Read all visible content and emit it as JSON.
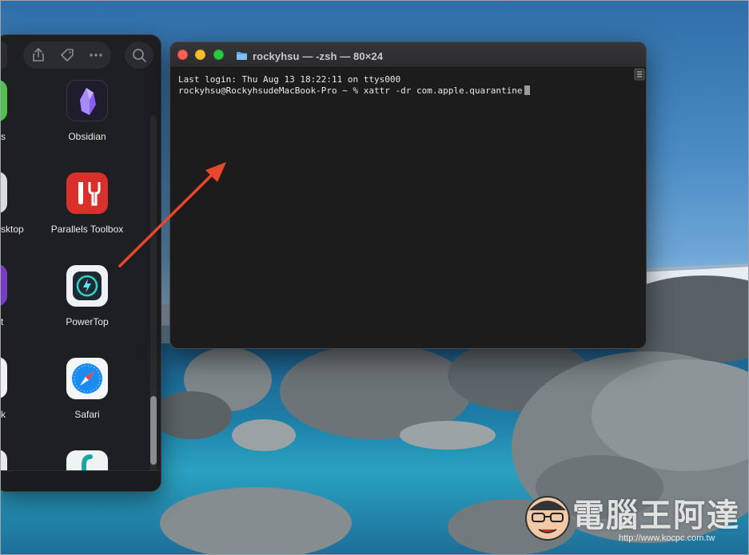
{
  "launcher": {
    "apps": [
      {
        "name": "Obsidian",
        "color": "#1f1c2b"
      },
      {
        "name": "Parallels Toolbox",
        "color": "#d9302c"
      },
      {
        "name": "PowerTop",
        "color": "#eef2f4"
      },
      {
        "name": "Safari",
        "color": "#f4f6f8"
      }
    ],
    "left_column_labels": [
      "s",
      "sktop",
      "t",
      "k"
    ]
  },
  "terminal": {
    "title": "rockyhsu — -zsh — 80×24",
    "lines": [
      "Last login: Thu Aug 13 18:22:11 on ttys000",
      "rockyhsu@RockyhsudeMacBook-Pro ~ % xattr -dr com.apple.quarantine"
    ]
  },
  "watermark": {
    "brand": "電腦王阿達",
    "url": "http://www.kocpc.com.tw"
  },
  "colors": {
    "arrow": "#e8472a",
    "close": "#fe5f57",
    "minimize": "#febc2e",
    "maximize": "#28c840"
  }
}
